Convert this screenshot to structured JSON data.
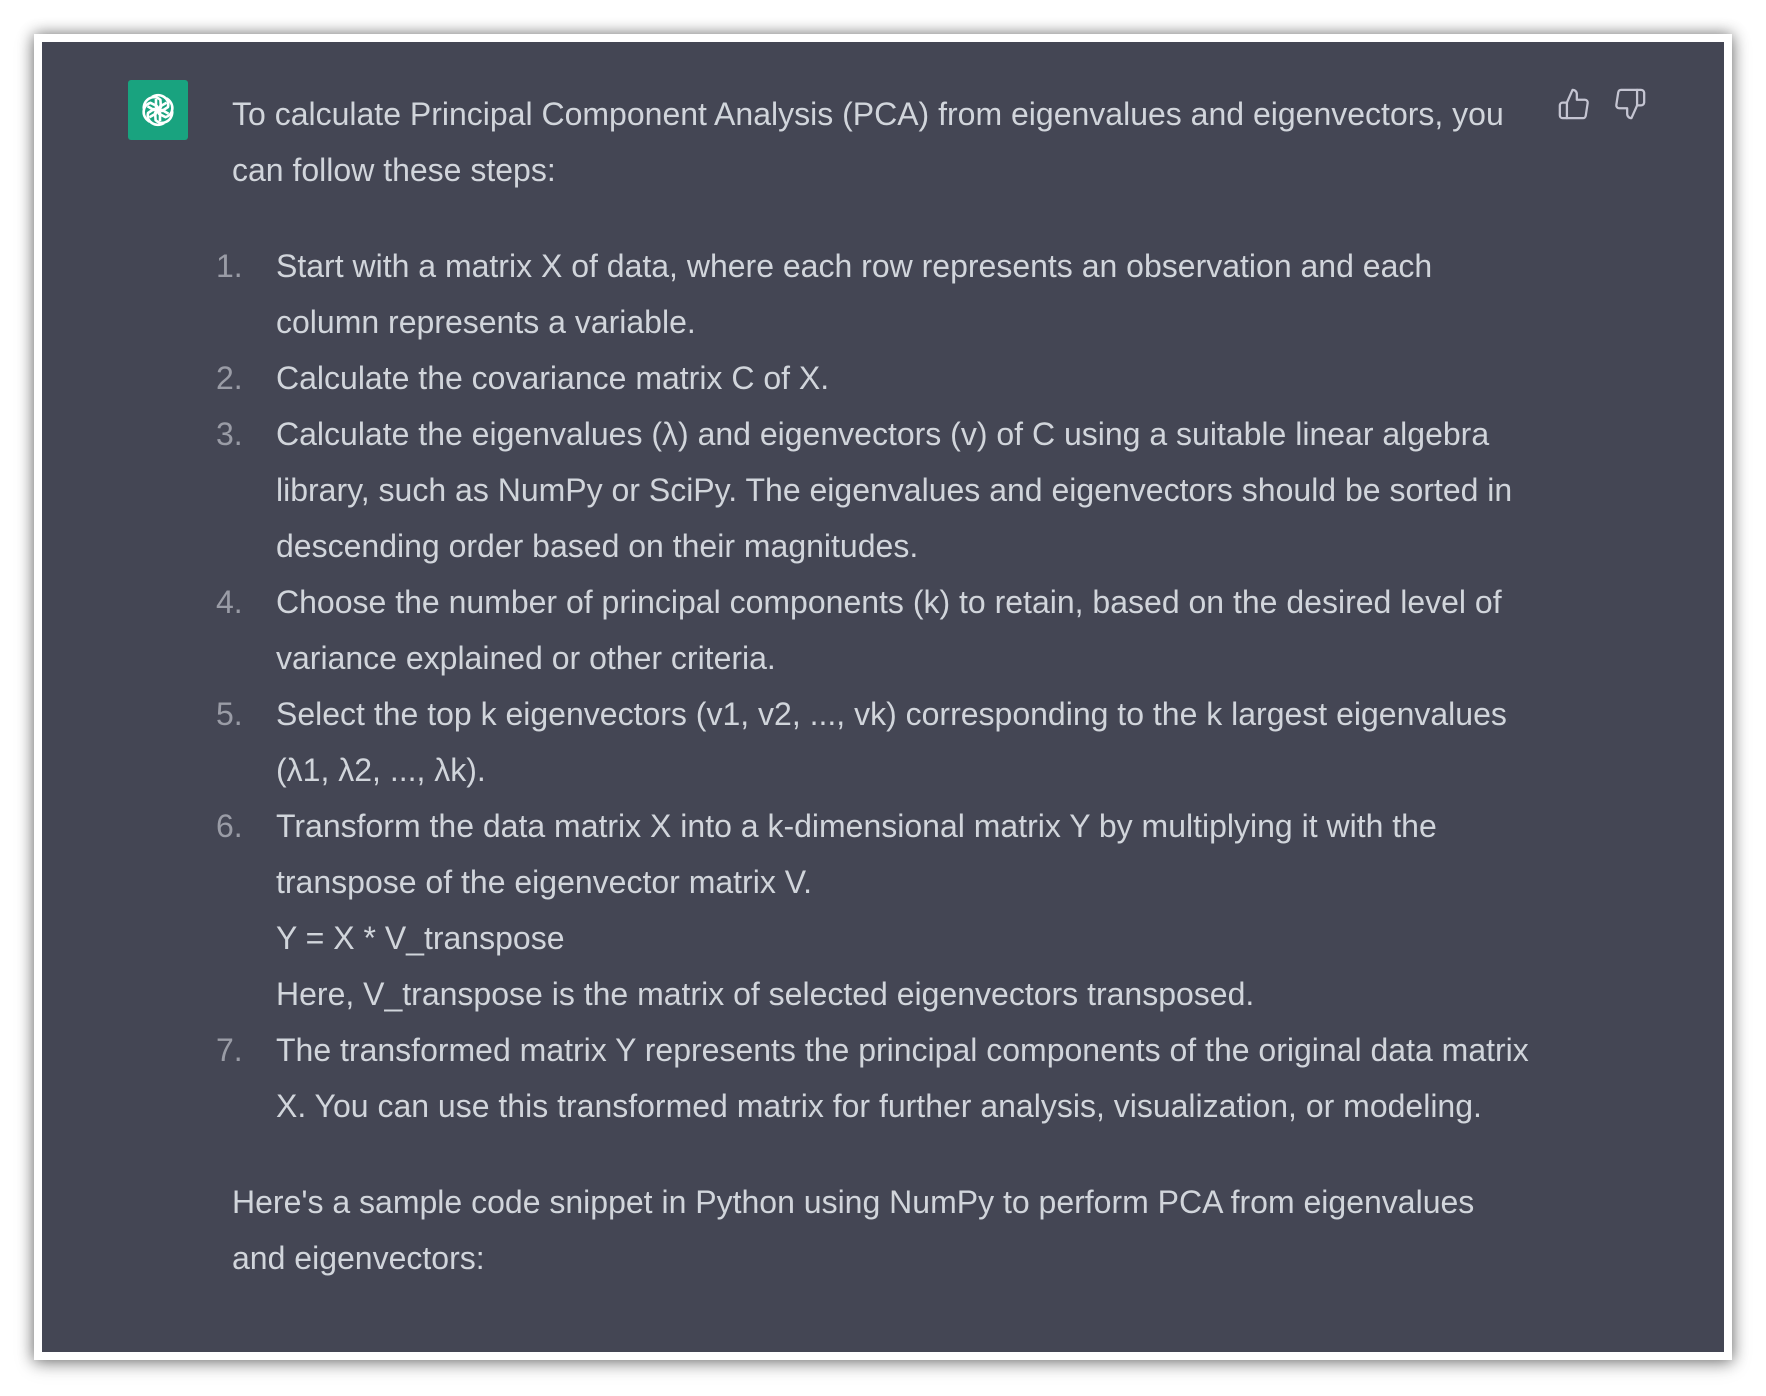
{
  "colors": {
    "panel_background": "#444654",
    "text": "#d1d5db",
    "list_number": "#9a9ca6",
    "avatar_background": "#19a37f",
    "icon": "#c5c5d2"
  },
  "icons": {
    "avatar": "openai-logo-icon",
    "thumbs_up": "thumbs-up-icon",
    "thumbs_down": "thumbs-down-icon"
  },
  "message": {
    "intro": "To calculate Principal Component Analysis (PCA) from eigenvalues and eigenvectors, you can follow these steps:",
    "steps": [
      {
        "number": "1.",
        "text": "Start with a matrix X of data, where each row represents an observation and each column represents a variable."
      },
      {
        "number": "2.",
        "text": "Calculate the covariance matrix C of X."
      },
      {
        "number": "3.",
        "text": "Calculate the eigenvalues (λ) and eigenvectors (v) of C using a suitable linear algebra library, such as NumPy or SciPy. The eigenvalues and eigenvectors should be sorted in descending order based on their magnitudes."
      },
      {
        "number": "4.",
        "text": "Choose the number of principal components (k) to retain, based on the desired level of variance explained or other criteria."
      },
      {
        "number": "5.",
        "text": "Select the top k eigenvectors (v1, v2, ..., vk) corresponding to the k largest eigenvalues (λ1, λ2, ..., λk)."
      },
      {
        "number": "6.",
        "text": "Transform the data matrix X into a k-dimensional matrix Y by multiplying it with the transpose of the eigenvector matrix V.",
        "formula": "Y = X * V_transpose",
        "note": "Here, V_transpose is the matrix of selected eigenvectors transposed."
      },
      {
        "number": "7.",
        "text": "The transformed matrix Y represents the principal components of the original data matrix X. You can use this transformed matrix for further analysis, visualization, or modeling."
      }
    ],
    "outro": "Here's a sample code snippet in Python using NumPy to perform PCA from eigenvalues and eigenvectors:"
  }
}
